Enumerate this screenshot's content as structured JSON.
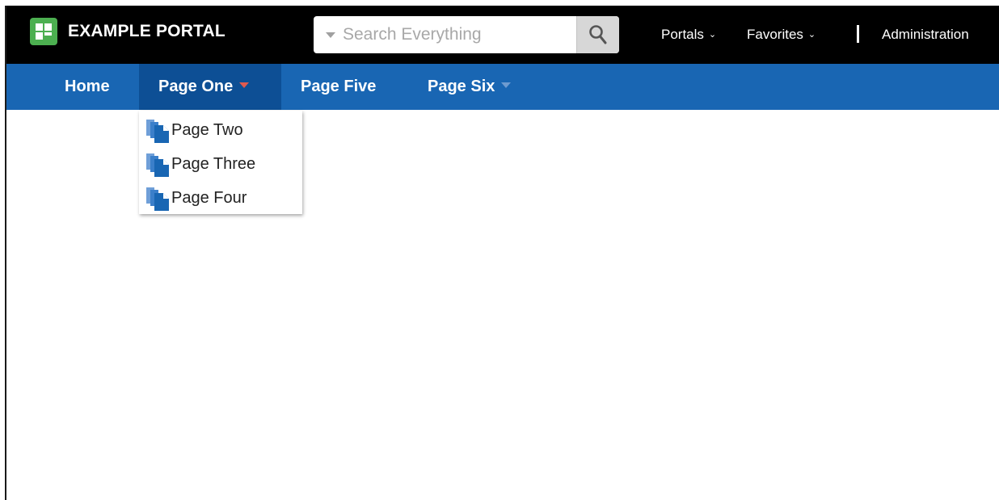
{
  "header": {
    "title": "EXAMPLE PORTAL",
    "logo_icon": "grid-logo-icon",
    "search": {
      "placeholder": "Search Everything",
      "value": "",
      "button_icon": "magnifier-icon",
      "scope_icon": "caret-down-icon"
    },
    "links": [
      {
        "label": "Portals",
        "chevron": "⌄"
      },
      {
        "label": "Favorites",
        "chevron": "⌄"
      },
      {
        "label": "Administration"
      }
    ]
  },
  "nav": {
    "tabs": [
      {
        "label": "Home",
        "active": false,
        "has_menu": false
      },
      {
        "label": "Page One",
        "active": true,
        "has_menu": true
      },
      {
        "label": "Page Five",
        "active": false,
        "has_menu": false
      },
      {
        "label": "Page Six",
        "active": false,
        "has_menu": true
      }
    ]
  },
  "dropdown": {
    "items": [
      {
        "label": "Page Two",
        "icon": "pages-icon"
      },
      {
        "label": "Page Three",
        "icon": "pages-icon"
      },
      {
        "label": "Page Four",
        "icon": "pages-icon"
      }
    ]
  },
  "colors": {
    "topbar": "#000000",
    "navbar": "#1966b3",
    "navbar_active": "#0d4f95",
    "logo_green": "#4caf50",
    "page_icon_blue": "#1966b3"
  }
}
